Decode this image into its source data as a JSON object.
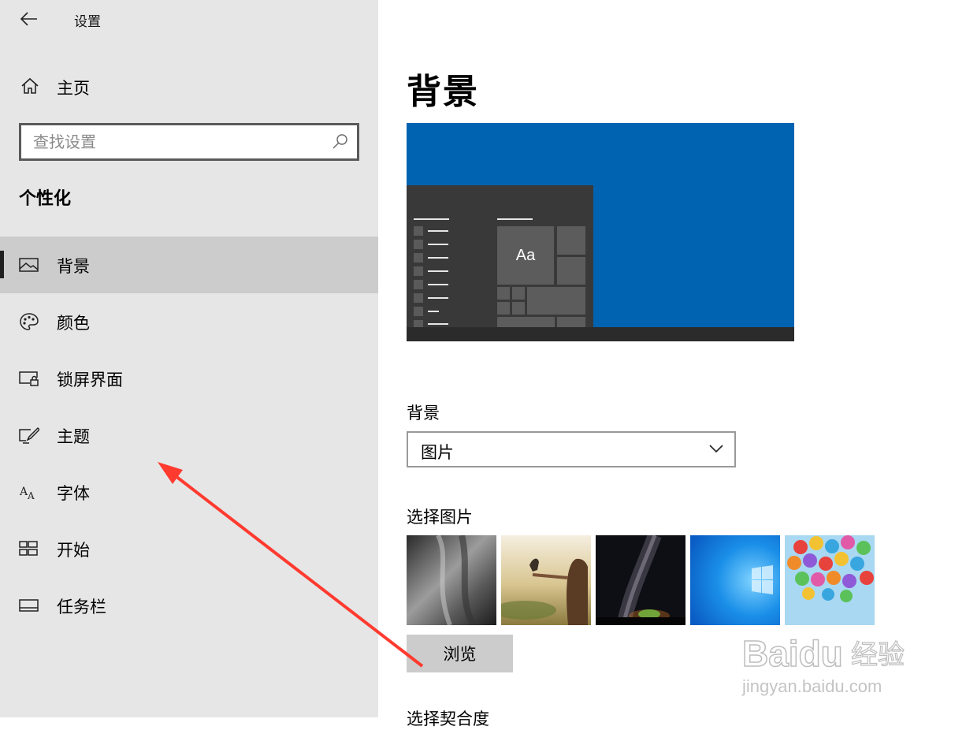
{
  "window": {
    "title": "设置",
    "back_icon": "arrow-left-icon"
  },
  "sidebar": {
    "home_label": "主页",
    "search_placeholder": "查找设置",
    "section_title": "个性化",
    "items": [
      {
        "label": "背景",
        "icon": "picture-icon",
        "active": true
      },
      {
        "label": "颜色",
        "icon": "palette-icon"
      },
      {
        "label": "锁屏界面",
        "icon": "lock-screen-icon"
      },
      {
        "label": "主题",
        "icon": "theme-brush-icon"
      },
      {
        "label": "字体",
        "icon": "font-icon"
      },
      {
        "label": "开始",
        "icon": "start-icon"
      },
      {
        "label": "任务栏",
        "icon": "taskbar-icon"
      }
    ]
  },
  "main": {
    "title": "背景",
    "preview": {
      "tile_text": "Aa",
      "desktop_color": "#0063b1"
    },
    "background_label": "背景",
    "background_value": "图片",
    "choose_picture_label": "选择图片",
    "browse_label": "浏览",
    "fit_label": "选择契合度"
  },
  "watermark": {
    "brand": "Baidu",
    "brand_cn": "经验",
    "url": "jingyan.baidu.com"
  },
  "colors": {
    "sidebar_bg": "#e6e6e6",
    "active_item_bg": "#cccccc",
    "accent_blue": "#0063b1",
    "annotation_arrow": "#ff3b30"
  }
}
